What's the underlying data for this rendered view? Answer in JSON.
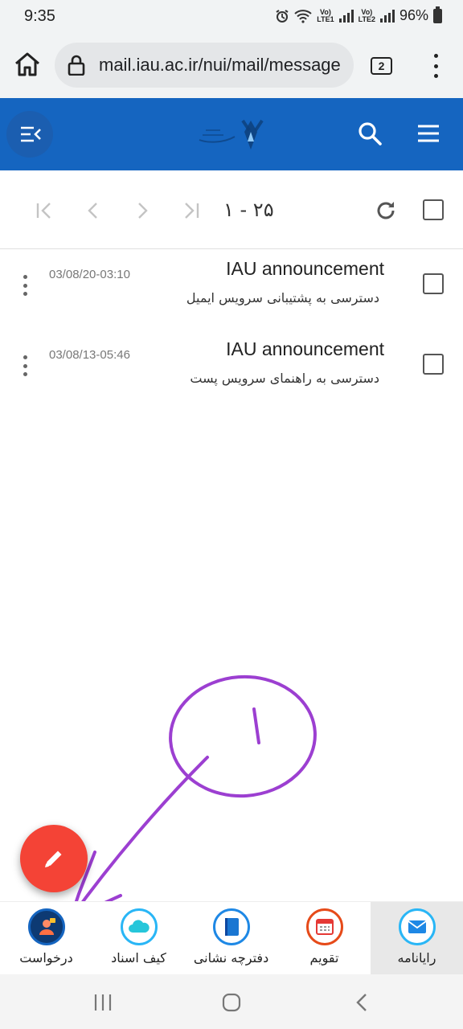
{
  "status_bar": {
    "time": "9:35",
    "battery": "96%",
    "sim1": "Vo) LTE1",
    "sim2": "Vo) LTE2"
  },
  "browser": {
    "url": "mail.iau.ac.ir/nui/mail/message",
    "tab_count": "2"
  },
  "toolbar": {
    "page_range": "۱ - ۲۵"
  },
  "messages": [
    {
      "subject": "IAU announcement",
      "date": "03/08/20-03:10",
      "preview": "دسترسی به پشتیبانی سرویس ایمیل"
    },
    {
      "subject": "IAU announcement",
      "date": "03/08/13-05:46",
      "preview": "دسترسی به راهنمای سرویس پست"
    }
  ],
  "annotation": {
    "number": "١"
  },
  "bottom_nav": [
    {
      "label": "رایانامه",
      "icon": "mail-icon",
      "active": true
    },
    {
      "label": "تقویم",
      "icon": "calendar-icon",
      "active": false
    },
    {
      "label": "دفترچه نشانی",
      "icon": "address-book-icon",
      "active": false
    },
    {
      "label": "کیف اسناد",
      "icon": "cloud-icon",
      "active": false
    },
    {
      "label": "درخواست",
      "icon": "request-icon",
      "active": false
    }
  ],
  "colors": {
    "header": "#1565c0",
    "fab": "#f44336",
    "nav_ring": "#29b6f6",
    "annotation": "#9c3fd1"
  }
}
